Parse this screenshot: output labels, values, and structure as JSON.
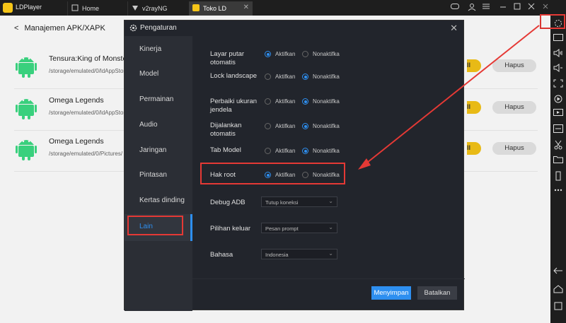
{
  "titlebar": {
    "app_name": "LDPlayer",
    "tabs": [
      {
        "label": "Home"
      },
      {
        "label": "v2rayNG"
      },
      {
        "label": "Toko LD"
      }
    ],
    "tab_close": "✕"
  },
  "page": {
    "title": "Manajemen APK/XAPK",
    "back": "<",
    "items": [
      {
        "name": "Tensura:King of Monsters",
        "path": "/storage/emulated/0/ldAppStore/",
        "install_label": "ll",
        "delete_label": "Hapus"
      },
      {
        "name": "Omega Legends",
        "path": "/storage/emulated/0/ldAppStore/",
        "install_label": "ll",
        "delete_label": "Hapus"
      },
      {
        "name": "Omega Legends",
        "path": "/storage/emulated/0/Pictures/",
        "install_label": "ll",
        "delete_label": "Hapus"
      }
    ]
  },
  "modal": {
    "title": "Pengaturan",
    "close": "✕",
    "sidebar": [
      {
        "label": "Kinerja"
      },
      {
        "label": "Model"
      },
      {
        "label": "Permainan"
      },
      {
        "label": "Audio"
      },
      {
        "label": "Jaringan"
      },
      {
        "label": "Pintasan"
      },
      {
        "label": "Kertas dinding"
      },
      {
        "label": "Lain",
        "active": true
      }
    ],
    "settings": [
      {
        "label": "Layar putar otomatis",
        "on": "Aktifkan",
        "off": "Nonaktifka",
        "value": "on"
      },
      {
        "label": "Lock landscape",
        "on": "Aktifkan",
        "off": "Nonaktifka",
        "value": "off"
      },
      {
        "label": "Perbaiki ukuran jendela",
        "on": "Aktifkan",
        "off": "Nonaktifka",
        "value": "off"
      },
      {
        "label": "Dijalankan otomatis",
        "on": "Aktifkan",
        "off": "Nonaktifka",
        "value": "off"
      },
      {
        "label": "Tab Model",
        "on": "Aktifkan",
        "off": "Nonaktifka",
        "value": "off"
      },
      {
        "label": "Hak root",
        "on": "Aktifkan",
        "off": "Nonaktifka",
        "value": "on"
      }
    ],
    "debug_adb": {
      "label": "Debug ADB",
      "value": "Tutup koneksi"
    },
    "exit_option": {
      "label": "Pilihan keluar",
      "value": "Pesan prompt"
    },
    "language": {
      "label": "Bahasa",
      "value": "Indonesia"
    },
    "save_label": "Menyimpan",
    "cancel_label": "Batalkan"
  },
  "colors": {
    "accent": "#2e8ff0",
    "highlight": "#e53935",
    "install": "#f5c518"
  }
}
